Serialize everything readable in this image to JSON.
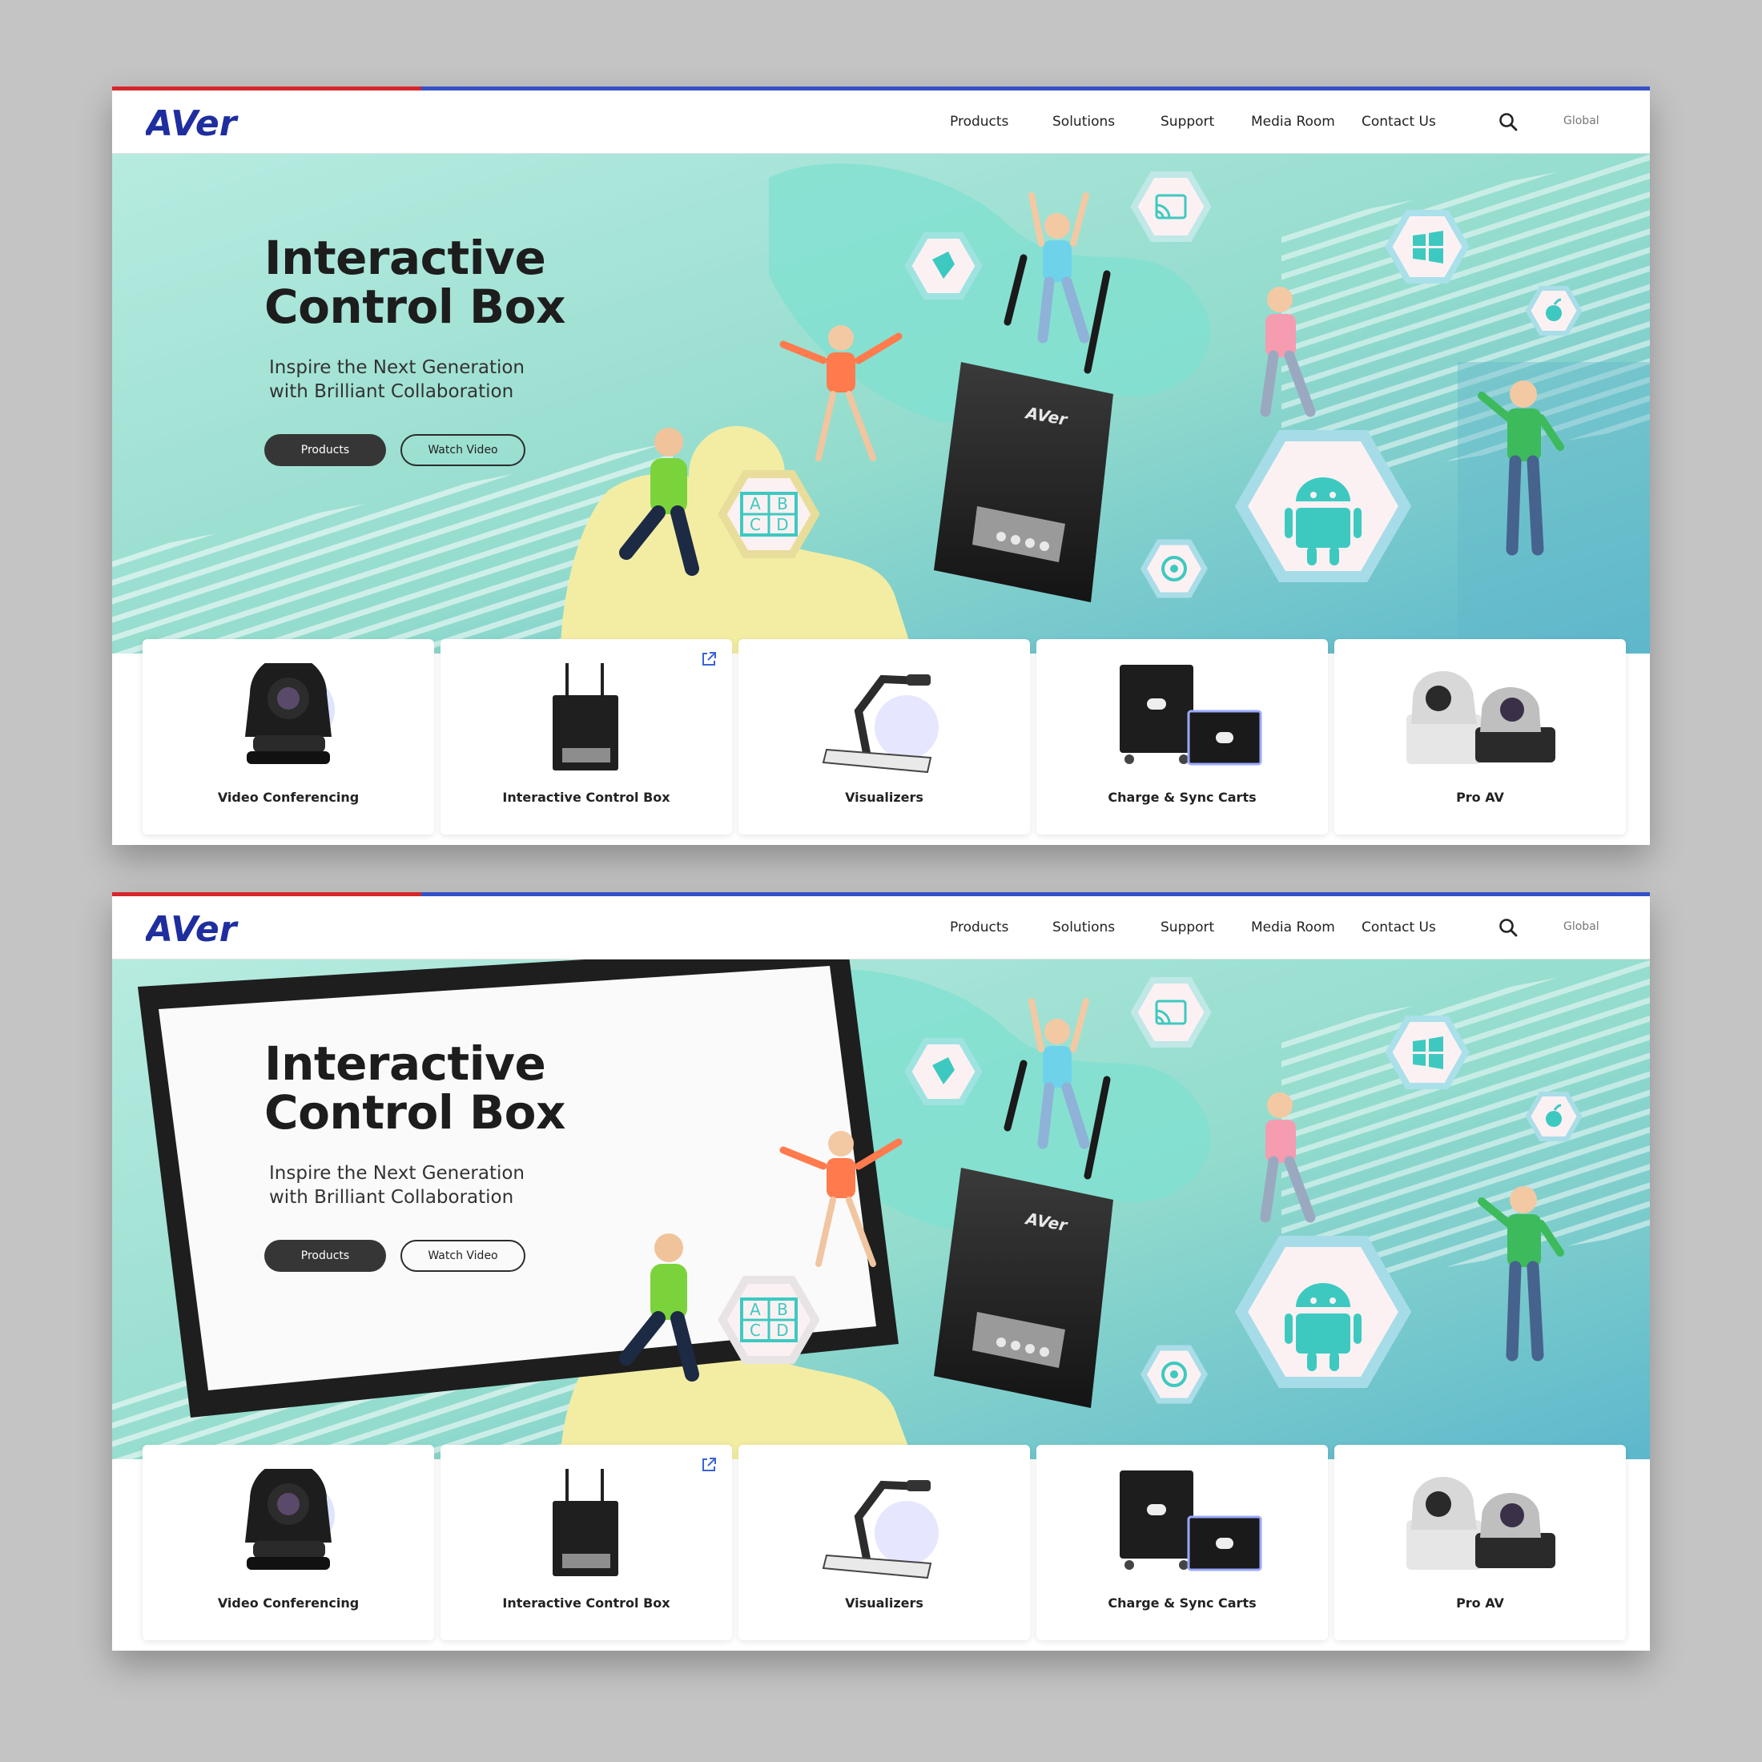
{
  "brand": {
    "logo_text": "AVer",
    "colors": {
      "red": "#d6262b",
      "blue": "#3451c7",
      "mint": "#a9e5d8",
      "teal": "#6cc4d2",
      "yellow": "#f3eda4",
      "dark": "#363636"
    }
  },
  "nav": {
    "items": [
      "Products",
      "Solutions",
      "Support",
      "Media Room",
      "Contact Us"
    ],
    "search_icon": "search-icon",
    "region": "Global"
  },
  "hero": {
    "title_line1": "Interactive",
    "title_line2": "Control Box",
    "subtitle_line1": "Inspire the Next Generation",
    "subtitle_line2": "with Brilliant Collaboration",
    "primary_button": "Products",
    "secondary_button": "Watch Video",
    "device_brand": "AVer",
    "abcd": [
      "A",
      "B",
      "C",
      "D"
    ],
    "hex_icons": [
      "cast-icon",
      "windows-icon",
      "tag-icon",
      "apple-icon",
      "android-icon",
      "chrome-icon",
      "abcd-grid-icon"
    ]
  },
  "products": [
    {
      "label": "Video Conferencing",
      "icon": "ptz-camera-icon"
    },
    {
      "label": "Interactive Control Box",
      "icon": "control-box-icon",
      "external_link_icon": "external-link-icon"
    },
    {
      "label": "Visualizers",
      "icon": "document-camera-icon"
    },
    {
      "label": "Charge & Sync Carts",
      "icon": "charging-cart-icon"
    },
    {
      "label": "Pro AV",
      "icon": "pro-av-camera-icon"
    }
  ]
}
